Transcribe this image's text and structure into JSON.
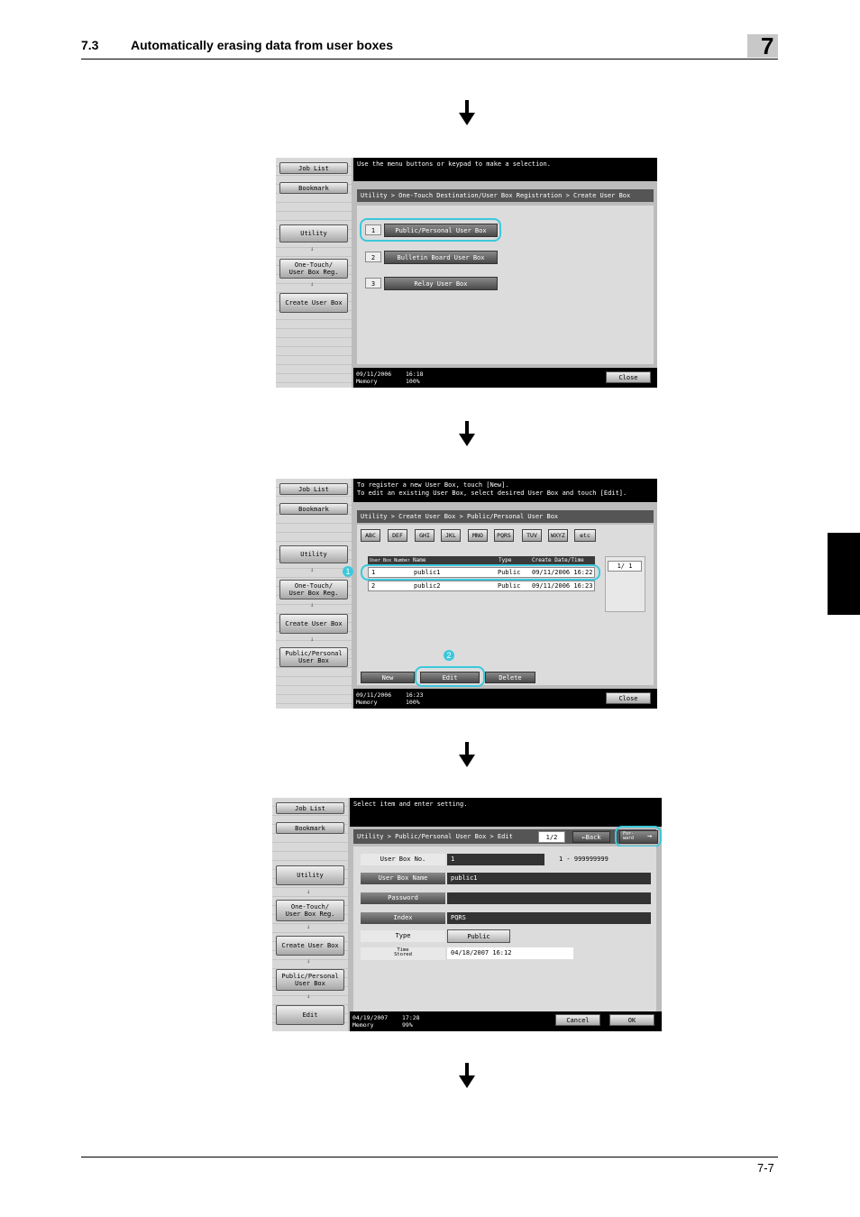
{
  "header": {
    "section_number": "7.3",
    "section_title": "Automatically erasing data from user boxes",
    "chapter": "7"
  },
  "footer": {
    "page": "7-7"
  },
  "sidebar_common": {
    "job_list": "Job List",
    "bookmark": "Bookmark",
    "utility": "Utility",
    "one_touch": "One-Touch/\nUser Box Reg.",
    "create_user_box": "Create User Box",
    "public_personal": "Public/Personal\nUser Box",
    "edit": "Edit"
  },
  "screen1": {
    "message": "Use the menu buttons or keypad to make a selection.",
    "breadcrumb": "Utility > One-Touch Destination/User Box Registration > Create User Box",
    "items": [
      {
        "num": "1",
        "label": "Public/Personal User Box"
      },
      {
        "num": "2",
        "label": "Bulletin Board User Box"
      },
      {
        "num": "3",
        "label": "Relay User Box"
      }
    ],
    "date": "09/11/2006",
    "time": "16:18",
    "memory_label": "Memory",
    "memory": "100%",
    "close": "Close"
  },
  "screen2": {
    "message_line1": "To register a new User Box, touch [New].",
    "message_line2": "To edit an existing User Box, select desired User Box and touch [Edit].",
    "breadcrumb": "Utility > Create User Box > Public/Personal User Box",
    "index_tabs": [
      "ABC",
      "DEF",
      "GHI",
      "JKL",
      "MNO",
      "PQRS",
      "TUV",
      "WXYZ",
      "etc"
    ],
    "columns": [
      "User Box Number",
      "Name",
      "Type",
      "Create Date/Time"
    ],
    "rows": [
      {
        "num": "1",
        "name": "public1",
        "type": "Public",
        "date": "09/11/2006  16:22"
      },
      {
        "num": "2",
        "name": "public2",
        "type": "Public",
        "date": "09/11/2006  16:23"
      }
    ],
    "page": "1/  1",
    "buttons": {
      "new": "New",
      "edit": "Edit",
      "delete": "Delete"
    },
    "callouts": [
      "1",
      "2"
    ],
    "date": "09/11/2006",
    "time": "16:23",
    "memory_label": "Memory",
    "memory": "100%",
    "close": "Close"
  },
  "screen3": {
    "message": "Select item and enter setting.",
    "breadcrumb": "Utility > Public/Personal User  Box > Edit",
    "page": "1/2",
    "back": "Back",
    "forward": "For-\nward",
    "fields": [
      {
        "label": "User Box No.",
        "value": "1",
        "hint": "1 - 999999999"
      },
      {
        "label": "User Box Name",
        "value": "public1"
      },
      {
        "label": "Password",
        "value": ""
      },
      {
        "label": "Index",
        "value": "PQRS"
      },
      {
        "label": "Type",
        "value": "Public"
      },
      {
        "label": "Time\nStored",
        "value": "04/18/2007  16:12"
      }
    ],
    "date": "04/19/2007",
    "time": "17:28",
    "memory_label": "Memory",
    "memory": "99%",
    "cancel": "Cancel",
    "ok": "OK"
  }
}
